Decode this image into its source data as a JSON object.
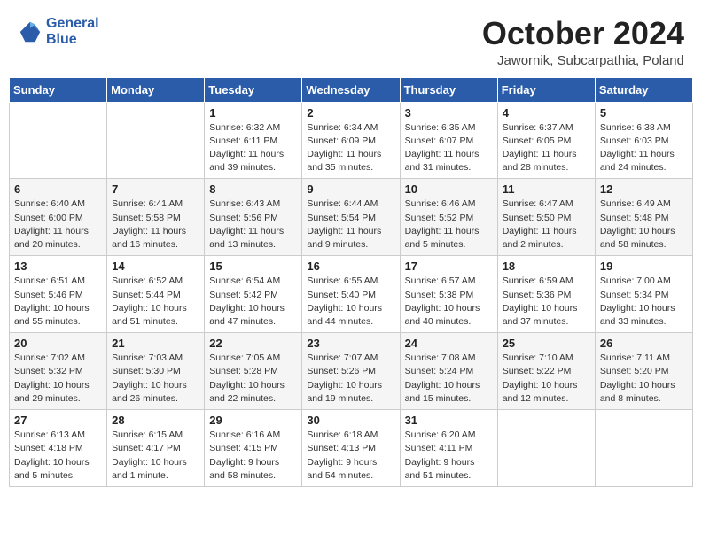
{
  "header": {
    "logo_line1": "General",
    "logo_line2": "Blue",
    "title": "October 2024",
    "subtitle": "Jawornik, Subcarpathia, Poland"
  },
  "days_of_week": [
    "Sunday",
    "Monday",
    "Tuesday",
    "Wednesday",
    "Thursday",
    "Friday",
    "Saturday"
  ],
  "weeks": [
    [
      {
        "day": "",
        "sunrise": "",
        "sunset": "",
        "daylight": ""
      },
      {
        "day": "",
        "sunrise": "",
        "sunset": "",
        "daylight": ""
      },
      {
        "day": "1",
        "sunrise": "Sunrise: 6:32 AM",
        "sunset": "Sunset: 6:11 PM",
        "daylight": "Daylight: 11 hours and 39 minutes."
      },
      {
        "day": "2",
        "sunrise": "Sunrise: 6:34 AM",
        "sunset": "Sunset: 6:09 PM",
        "daylight": "Daylight: 11 hours and 35 minutes."
      },
      {
        "day": "3",
        "sunrise": "Sunrise: 6:35 AM",
        "sunset": "Sunset: 6:07 PM",
        "daylight": "Daylight: 11 hours and 31 minutes."
      },
      {
        "day": "4",
        "sunrise": "Sunrise: 6:37 AM",
        "sunset": "Sunset: 6:05 PM",
        "daylight": "Daylight: 11 hours and 28 minutes."
      },
      {
        "day": "5",
        "sunrise": "Sunrise: 6:38 AM",
        "sunset": "Sunset: 6:03 PM",
        "daylight": "Daylight: 11 hours and 24 minutes."
      }
    ],
    [
      {
        "day": "6",
        "sunrise": "Sunrise: 6:40 AM",
        "sunset": "Sunset: 6:00 PM",
        "daylight": "Daylight: 11 hours and 20 minutes."
      },
      {
        "day": "7",
        "sunrise": "Sunrise: 6:41 AM",
        "sunset": "Sunset: 5:58 PM",
        "daylight": "Daylight: 11 hours and 16 minutes."
      },
      {
        "day": "8",
        "sunrise": "Sunrise: 6:43 AM",
        "sunset": "Sunset: 5:56 PM",
        "daylight": "Daylight: 11 hours and 13 minutes."
      },
      {
        "day": "9",
        "sunrise": "Sunrise: 6:44 AM",
        "sunset": "Sunset: 5:54 PM",
        "daylight": "Daylight: 11 hours and 9 minutes."
      },
      {
        "day": "10",
        "sunrise": "Sunrise: 6:46 AM",
        "sunset": "Sunset: 5:52 PM",
        "daylight": "Daylight: 11 hours and 5 minutes."
      },
      {
        "day": "11",
        "sunrise": "Sunrise: 6:47 AM",
        "sunset": "Sunset: 5:50 PM",
        "daylight": "Daylight: 11 hours and 2 minutes."
      },
      {
        "day": "12",
        "sunrise": "Sunrise: 6:49 AM",
        "sunset": "Sunset: 5:48 PM",
        "daylight": "Daylight: 10 hours and 58 minutes."
      }
    ],
    [
      {
        "day": "13",
        "sunrise": "Sunrise: 6:51 AM",
        "sunset": "Sunset: 5:46 PM",
        "daylight": "Daylight: 10 hours and 55 minutes."
      },
      {
        "day": "14",
        "sunrise": "Sunrise: 6:52 AM",
        "sunset": "Sunset: 5:44 PM",
        "daylight": "Daylight: 10 hours and 51 minutes."
      },
      {
        "day": "15",
        "sunrise": "Sunrise: 6:54 AM",
        "sunset": "Sunset: 5:42 PM",
        "daylight": "Daylight: 10 hours and 47 minutes."
      },
      {
        "day": "16",
        "sunrise": "Sunrise: 6:55 AM",
        "sunset": "Sunset: 5:40 PM",
        "daylight": "Daylight: 10 hours and 44 minutes."
      },
      {
        "day": "17",
        "sunrise": "Sunrise: 6:57 AM",
        "sunset": "Sunset: 5:38 PM",
        "daylight": "Daylight: 10 hours and 40 minutes."
      },
      {
        "day": "18",
        "sunrise": "Sunrise: 6:59 AM",
        "sunset": "Sunset: 5:36 PM",
        "daylight": "Daylight: 10 hours and 37 minutes."
      },
      {
        "day": "19",
        "sunrise": "Sunrise: 7:00 AM",
        "sunset": "Sunset: 5:34 PM",
        "daylight": "Daylight: 10 hours and 33 minutes."
      }
    ],
    [
      {
        "day": "20",
        "sunrise": "Sunrise: 7:02 AM",
        "sunset": "Sunset: 5:32 PM",
        "daylight": "Daylight: 10 hours and 29 minutes."
      },
      {
        "day": "21",
        "sunrise": "Sunrise: 7:03 AM",
        "sunset": "Sunset: 5:30 PM",
        "daylight": "Daylight: 10 hours and 26 minutes."
      },
      {
        "day": "22",
        "sunrise": "Sunrise: 7:05 AM",
        "sunset": "Sunset: 5:28 PM",
        "daylight": "Daylight: 10 hours and 22 minutes."
      },
      {
        "day": "23",
        "sunrise": "Sunrise: 7:07 AM",
        "sunset": "Sunset: 5:26 PM",
        "daylight": "Daylight: 10 hours and 19 minutes."
      },
      {
        "day": "24",
        "sunrise": "Sunrise: 7:08 AM",
        "sunset": "Sunset: 5:24 PM",
        "daylight": "Daylight: 10 hours and 15 minutes."
      },
      {
        "day": "25",
        "sunrise": "Sunrise: 7:10 AM",
        "sunset": "Sunset: 5:22 PM",
        "daylight": "Daylight: 10 hours and 12 minutes."
      },
      {
        "day": "26",
        "sunrise": "Sunrise: 7:11 AM",
        "sunset": "Sunset: 5:20 PM",
        "daylight": "Daylight: 10 hours and 8 minutes."
      }
    ],
    [
      {
        "day": "27",
        "sunrise": "Sunrise: 6:13 AM",
        "sunset": "Sunset: 4:18 PM",
        "daylight": "Daylight: 10 hours and 5 minutes."
      },
      {
        "day": "28",
        "sunrise": "Sunrise: 6:15 AM",
        "sunset": "Sunset: 4:17 PM",
        "daylight": "Daylight: 10 hours and 1 minute."
      },
      {
        "day": "29",
        "sunrise": "Sunrise: 6:16 AM",
        "sunset": "Sunset: 4:15 PM",
        "daylight": "Daylight: 9 hours and 58 minutes."
      },
      {
        "day": "30",
        "sunrise": "Sunrise: 6:18 AM",
        "sunset": "Sunset: 4:13 PM",
        "daylight": "Daylight: 9 hours and 54 minutes."
      },
      {
        "day": "31",
        "sunrise": "Sunrise: 6:20 AM",
        "sunset": "Sunset: 4:11 PM",
        "daylight": "Daylight: 9 hours and 51 minutes."
      },
      {
        "day": "",
        "sunrise": "",
        "sunset": "",
        "daylight": ""
      },
      {
        "day": "",
        "sunrise": "",
        "sunset": "",
        "daylight": ""
      }
    ]
  ]
}
